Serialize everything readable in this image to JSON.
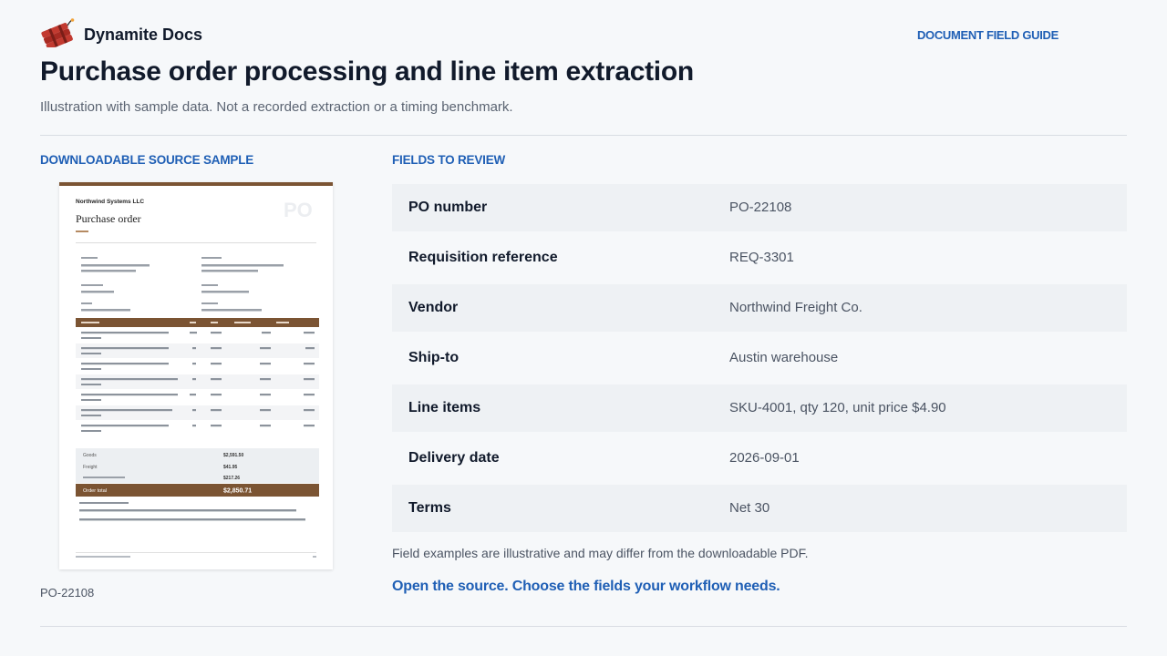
{
  "header": {
    "brand": "Dynamite Docs",
    "nav_link": "DOCUMENT FIELD GUIDE"
  },
  "page": {
    "title": "Purchase order processing and line item extraction",
    "subtitle": "Illustration with sample data. Not a recorded extraction or a timing benchmark."
  },
  "source": {
    "label": "DOWNLOADABLE SOURCE SAMPLE",
    "caption": "PO-22108",
    "document": {
      "company": "Northwind Systems LLC",
      "heading": "Purchase order",
      "watermark": "PO",
      "order_total_label": "Order total",
      "order_total": "$2,850.71",
      "goods_label": "Goods",
      "goods": "$2,591.50",
      "freight_label": "Freight",
      "freight": "$41.95",
      "tax": "$217.26"
    }
  },
  "fields_section": {
    "label": "FIELDS TO REVIEW",
    "rows": [
      {
        "label": "PO number",
        "value": "PO-22108"
      },
      {
        "label": "Requisition reference",
        "value": "REQ-3301"
      },
      {
        "label": "Vendor",
        "value": "Northwind Freight Co."
      },
      {
        "label": "Ship-to",
        "value": "Austin warehouse"
      },
      {
        "label": "Line items",
        "value": "SKU-4001, qty 120, unit price $4.90"
      },
      {
        "label": "Delivery date",
        "value": "2026-09-01"
      },
      {
        "label": "Terms",
        "value": "Net 30"
      }
    ],
    "note": "Field examples are illustrative and may differ from the downloadable PDF.",
    "cta": "Open the source. Choose the fields your workflow needs."
  },
  "colors": {
    "accent": "#1f5fb5",
    "doc_brown": "#7b5433",
    "row_shade": "#eef1f4"
  }
}
